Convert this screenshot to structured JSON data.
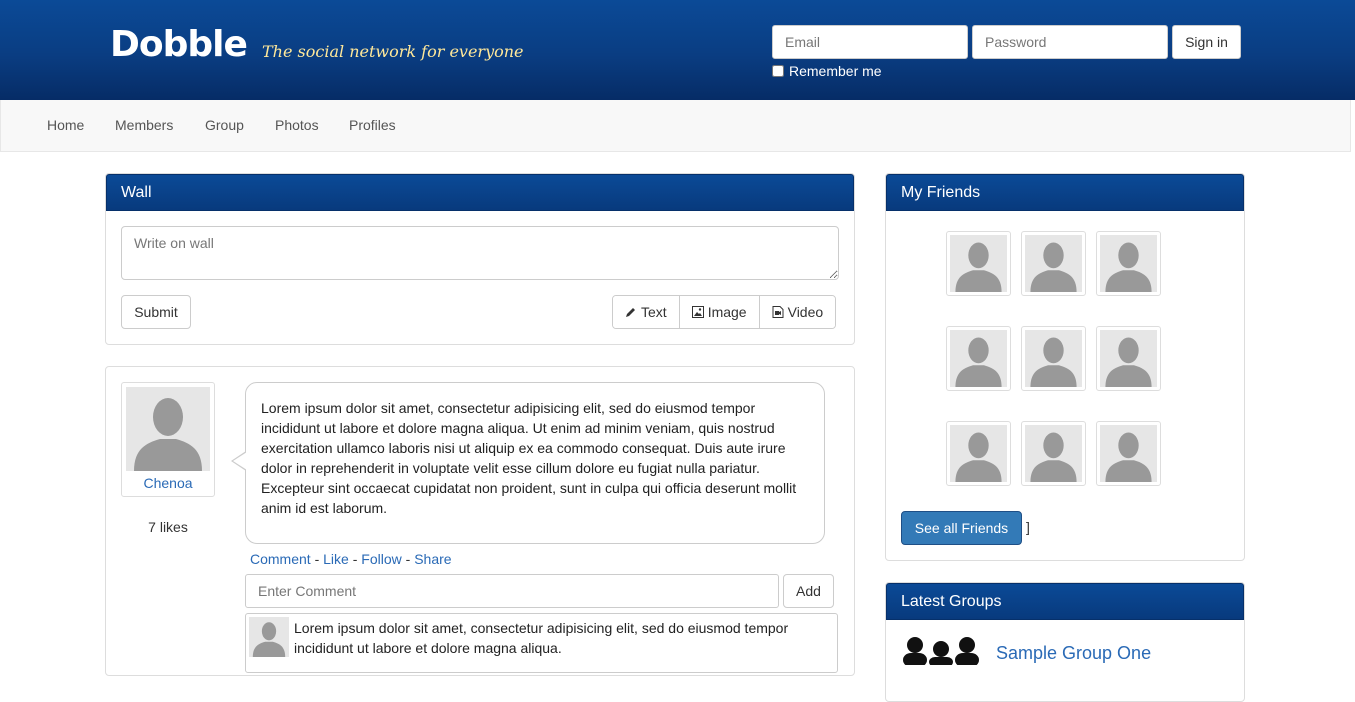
{
  "header": {
    "logo": "Dobble",
    "tagline": "The social network for everyone",
    "email_placeholder": "Email",
    "password_placeholder": "Password",
    "signin_label": "Sign in",
    "remember_label": "Remember me"
  },
  "nav": {
    "items": [
      "Home",
      "Members",
      "Group",
      "Photos",
      "Profiles"
    ]
  },
  "wall": {
    "title": "Wall",
    "textarea_placeholder": "Write on wall",
    "submit_label": "Submit",
    "types": {
      "text": "Text",
      "image": "Image",
      "video": "Video"
    }
  },
  "post": {
    "author": "Chenoa",
    "likes": "7 likes",
    "body": "Lorem ipsum dolor sit amet, consectetur adipisicing elit, sed do eiusmod tempor incididunt ut labore et dolore magna aliqua. Ut enim ad minim veniam, quis nostrud exercitation ullamco laboris nisi ut aliquip ex ea commodo consequat. Duis aute irure dolor in reprehenderit in voluptate velit esse cillum dolore eu fugiat nulla pariatur. Excepteur sint occaecat cupidatat non proident, sunt in culpa qui officia deserunt mollit anim id est laborum.",
    "actions": {
      "comment": "Comment",
      "like": "Like",
      "follow": "Follow",
      "share": "Share",
      "separator": "-"
    },
    "comment_placeholder": "Enter Comment",
    "add_label": "Add",
    "comment": {
      "text": "Lorem ipsum dolor sit amet, consectetur adipisicing elit, sed do eiusmod tempor incididunt ut labore et dolore magna aliqua."
    }
  },
  "friends": {
    "title": "My Friends",
    "see_all_label": "See all Friends",
    "trailing": "]"
  },
  "groups": {
    "title": "Latest Groups",
    "items": [
      "Sample Group One"
    ]
  },
  "colors": {
    "header_blue": "#0a3d82",
    "link_blue": "#2a6ab6",
    "tagline_yellow": "#ffe89a",
    "primary_button": "#337ab7"
  }
}
